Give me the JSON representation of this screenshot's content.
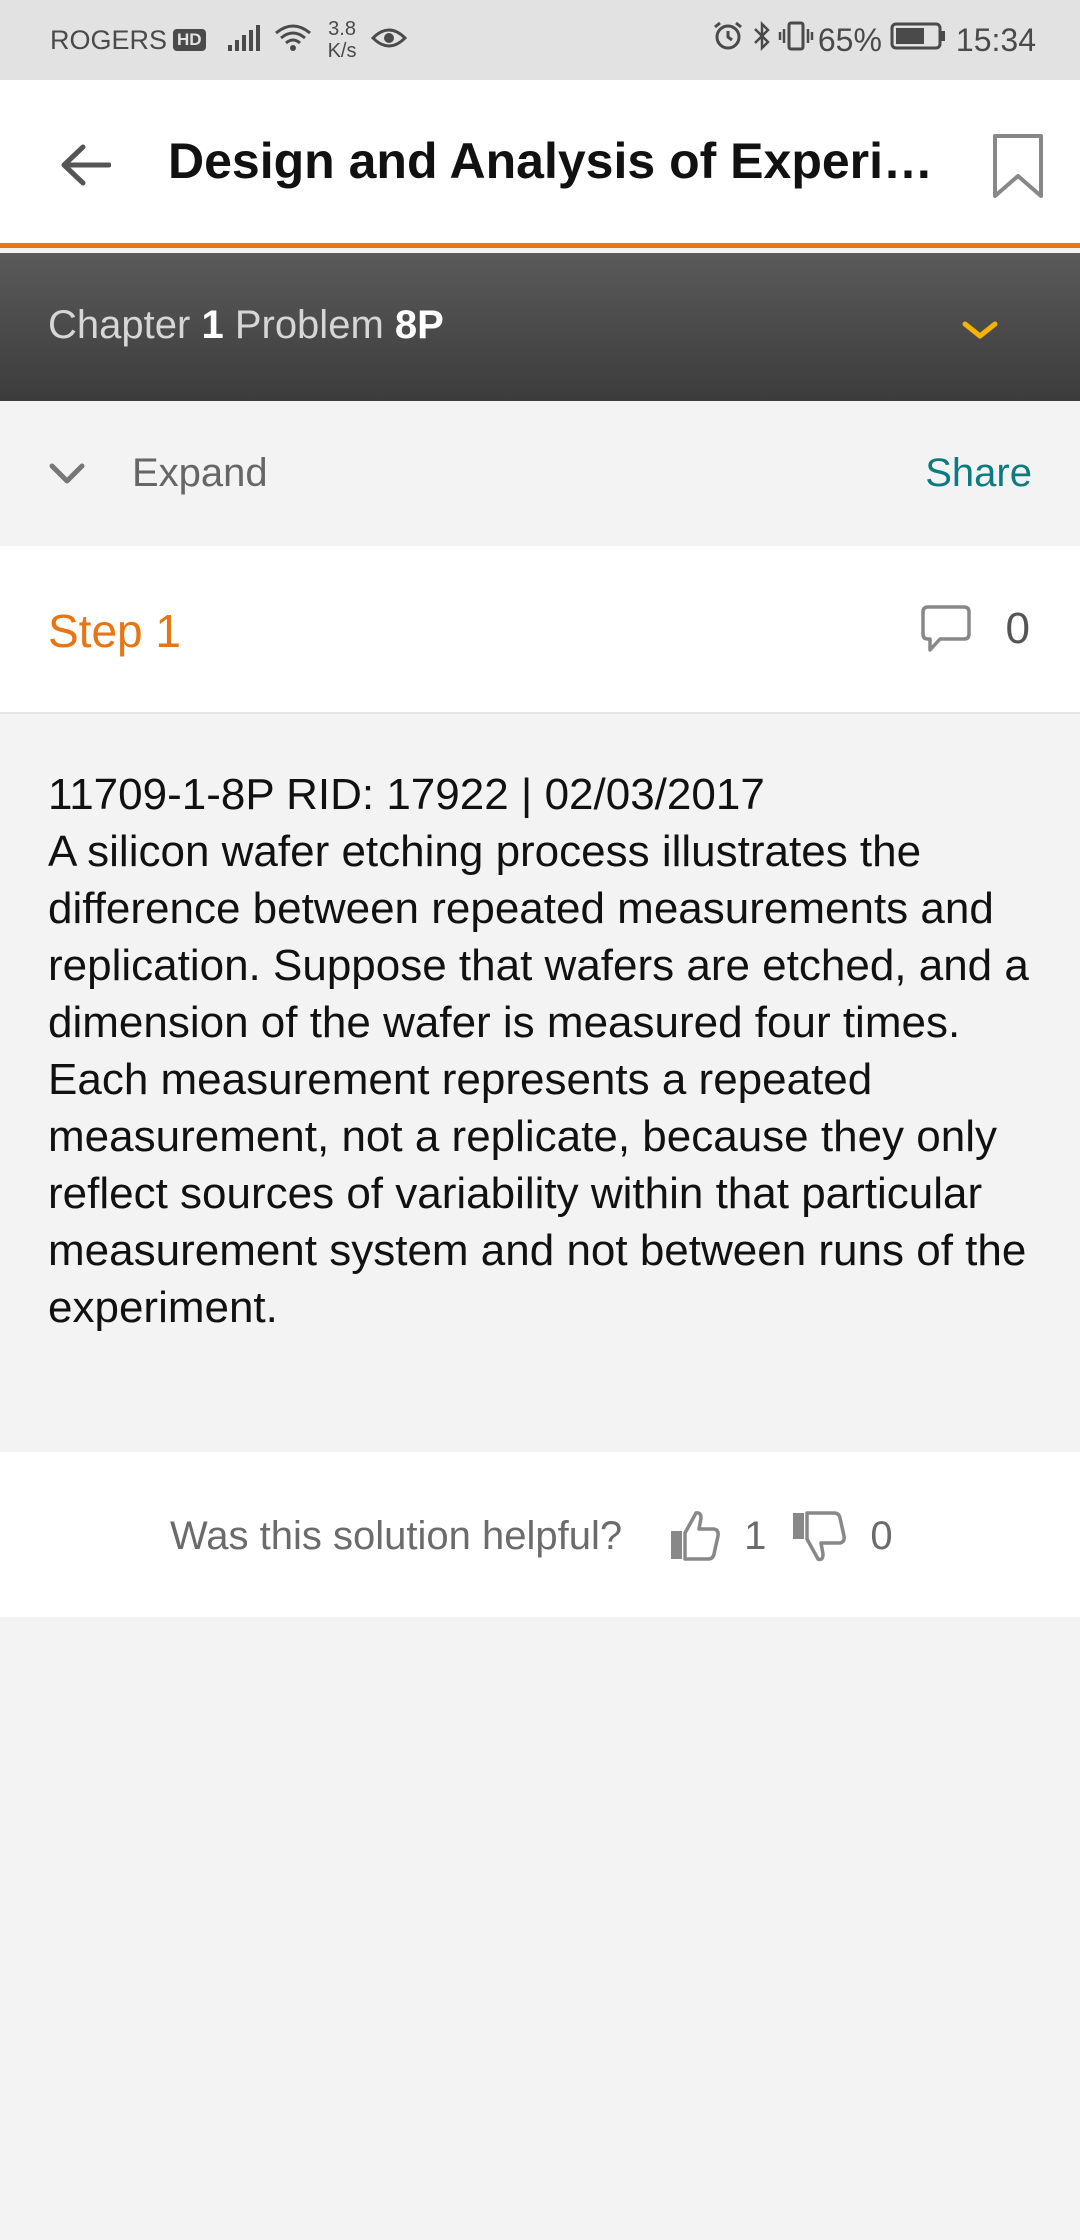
{
  "status_bar": {
    "carrier": "ROGERS",
    "hd_badge": "HD",
    "speed_value": "3.8",
    "speed_unit": "K/s",
    "battery_percent": "65%",
    "time": "15:34"
  },
  "app_bar": {
    "title": "Design and Analysis of Experiments"
  },
  "chapter_bar": {
    "chapter_label": "Chapter",
    "chapter_number": "1",
    "problem_label": "Problem",
    "problem_number": "8P"
  },
  "actions": {
    "expand_label": "Expand",
    "share_label": "Share"
  },
  "step": {
    "title": "Step 1",
    "comment_count": "0",
    "body": [
      "11709-1-8P RID: 17922 | 02/03/2017",
      "A silicon wafer etching process illustrates the difference between repeated measurements and replication. Suppose that wafers are etched, and a dimension of the wafer is measured four times.",
      "Each measurement represents a repeated measurement, not a replicate, because they only reflect sources of variability within that particular measurement system and not between runs of the experiment."
    ]
  },
  "helpful": {
    "question": "Was this solution helpful?",
    "thumbs_up_count": "1",
    "thumbs_down_count": "0"
  },
  "colors": {
    "accent_orange": "#e87511",
    "share_teal": "#0b7b80",
    "dropdown_yellow": "#f5b400"
  }
}
